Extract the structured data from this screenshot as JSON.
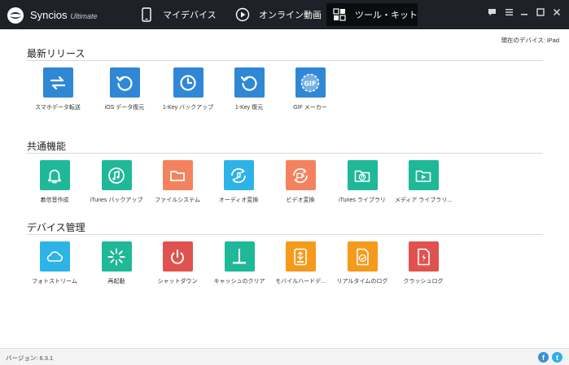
{
  "app": {
    "name": "Syncios",
    "edition": "Ultimate"
  },
  "nav": {
    "tabs": [
      {
        "label": "マイデバイス",
        "icon": "phone-icon"
      },
      {
        "label": "オンライン動画",
        "icon": "play-icon"
      },
      {
        "label": "ツール・キット",
        "icon": "toolkit-grid-icon",
        "active": true
      }
    ]
  },
  "window_controls": [
    "message-icon",
    "menu-icon",
    "minimize-icon",
    "maximize-icon",
    "close-icon"
  ],
  "device": {
    "label": "現在のデバイス: iPad"
  },
  "sections": [
    {
      "title": "最新リリース",
      "tools": [
        {
          "label": "スマホデータ転送",
          "icon": "transfer-icon",
          "color": "#2f87d6"
        },
        {
          "label": "iOS データ復元",
          "icon": "restore-icon",
          "color": "#2f87d6"
        },
        {
          "label": "1-Key バックアップ",
          "icon": "backup-clock-icon",
          "color": "#2f87d6"
        },
        {
          "label": "1-Key 復元",
          "icon": "restore-icon",
          "color": "#2f87d6"
        },
        {
          "label": "GIF メーカー",
          "icon": "gif-icon",
          "color": "#2f87d6"
        }
      ]
    },
    {
      "title": "共通機能",
      "tools": [
        {
          "label": "着信音作成",
          "icon": "bell-icon",
          "color": "#1fb898"
        },
        {
          "label": "iTunes バックアップ",
          "icon": "itunes-note-icon",
          "color": "#1fb898"
        },
        {
          "label": "ファイルシステム",
          "icon": "folder-icon",
          "color": "#f5825e"
        },
        {
          "label": "オーディオ変換",
          "icon": "audio-convert-icon",
          "color": "#2eb3e8"
        },
        {
          "label": "ビデオ変換",
          "icon": "video-convert-icon",
          "color": "#f5825e"
        },
        {
          "label": "iTunes ライブラリ",
          "icon": "music-folder-icon",
          "color": "#1fb898"
        },
        {
          "label": "メディア ライブラリ...",
          "icon": "media-folder-icon",
          "color": "#1fb898"
        }
      ]
    },
    {
      "title": "デバイス管理",
      "tools": [
        {
          "label": "フォトストリーム",
          "icon": "cloud-icon",
          "color": "#2eb3e8"
        },
        {
          "label": "再起動",
          "icon": "reboot-icon",
          "color": "#1fb898"
        },
        {
          "label": "シャットダウン",
          "icon": "power-icon",
          "color": "#e0524f"
        },
        {
          "label": "キャッシュのクリア",
          "icon": "clear-cache-icon",
          "color": "#1fb898"
        },
        {
          "label": "モバイルハードデ...",
          "icon": "usb-drive-icon",
          "color": "#f59a1b"
        },
        {
          "label": "リアルタイムのログ",
          "icon": "realtime-log-icon",
          "color": "#f59a1b"
        },
        {
          "label": "クラッシュログ",
          "icon": "crash-log-icon",
          "color": "#e0524f"
        }
      ]
    }
  ],
  "status": {
    "version": "バージョン: 6.3.1"
  },
  "social": [
    {
      "name": "facebook",
      "glyph": "f",
      "color": "#3b8fd9"
    },
    {
      "name": "twitter",
      "glyph": "t",
      "color": "#2eaee6"
    }
  ]
}
